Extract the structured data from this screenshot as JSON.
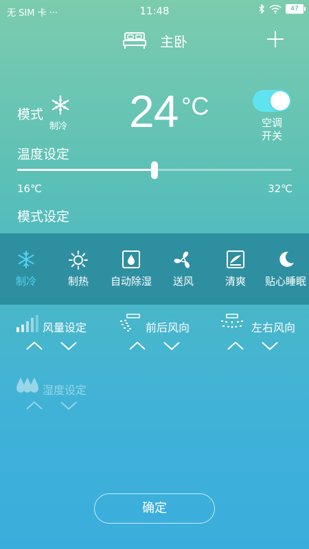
{
  "status": {
    "carrier": "无 SIM 卡 ···",
    "time": "11:48",
    "battery": "47"
  },
  "header": {
    "title": "主卧"
  },
  "current": {
    "mode_label": "模式",
    "mode_value": "制冷",
    "temperature": "24",
    "unit": "°C"
  },
  "power": {
    "label_line1": "空调",
    "label_line2": "开关",
    "on": true
  },
  "temp_setting": {
    "title": "温度设定",
    "min": "16℃",
    "max": "32℃",
    "value_fraction": 0.5
  },
  "mode_setting": {
    "title": "模式设定",
    "modes": [
      {
        "label": "制冷",
        "icon": "snowflake-icon",
        "active": true
      },
      {
        "label": "制热",
        "icon": "sun-icon",
        "active": false
      },
      {
        "label": "自动除湿",
        "icon": "dehumidify-icon",
        "active": false
      },
      {
        "label": "送风",
        "icon": "fan-icon",
        "active": false
      },
      {
        "label": "清爽",
        "icon": "fresh-icon",
        "active": false
      },
      {
        "label": "贴心睡眠",
        "icon": "moon-icon",
        "active": false
      }
    ]
  },
  "controls": {
    "fan_speed": "风量设定",
    "vertical_swing": "前后风向",
    "horizontal_swing": "左右风向",
    "humidity": "湿度设定"
  },
  "confirm_label": "确定",
  "colors": {
    "accent": "#53d2f0",
    "mode_bar": "#2e8fa0",
    "toggle_on": "#5fe3f0"
  }
}
